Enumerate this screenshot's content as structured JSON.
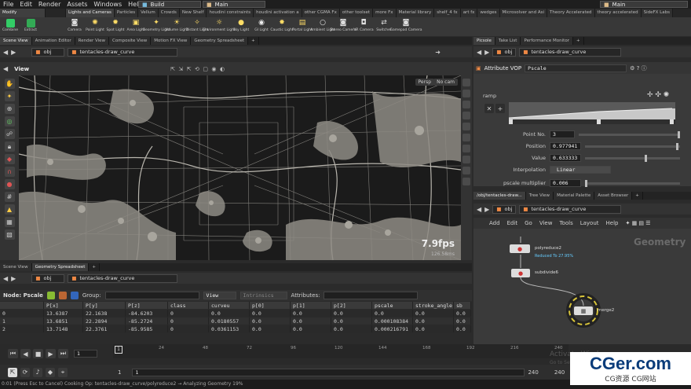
{
  "menubar": {
    "items": [
      "File",
      "Edit",
      "Render",
      "Assets",
      "Windows",
      "Help"
    ],
    "build_desk": "Build",
    "main_desk": "Main",
    "right_desk": "Main"
  },
  "shelf_tabs": [
    "Modify",
    "Lights and Cameras",
    "Particles",
    "Vellum",
    "Crowds",
    "New Shelf",
    "houdini constraints",
    "houdini activation a",
    "other CGMA Fx",
    "other toolset",
    "more Fx",
    "Material library",
    "shelf_4 fx",
    "art fx",
    "wedges",
    "Microsolver and Asi",
    "Theory Accelerated",
    "theory accelerated",
    "SideFX Labs"
  ],
  "tools_left": [
    "Combine",
    "Extract"
  ],
  "tools": [
    "Camera",
    "Point Light",
    "Spot Light",
    "Area Light",
    "Geometry Light",
    "Volume Light",
    "Distant Light",
    "Environment Light",
    "Sky Light",
    "GI Light",
    "Caustic Light",
    "Portal Light",
    "Ambient Light",
    "Stereo Camera",
    "VR Camera",
    "Switcher",
    "Gamepad Camera"
  ],
  "viewer": {
    "tabs": [
      "Scene View",
      "Animation Editor",
      "Render View",
      "Composite View",
      "Motion FX View",
      "Geometry Spreadsheet"
    ],
    "path_root": "obj",
    "path_node": "tentacles-draw_curve",
    "title": "View",
    "persp": "Persp",
    "cam": "No cam",
    "fps": "7.9fps",
    "ms": "126.58ms"
  },
  "right_top": {
    "tabs": [
      "Picsole",
      "Take List",
      "Performance Monitor"
    ],
    "path_root": "obj",
    "path_node": "tentacles-draw_curve",
    "node_type": "Attribute VOP",
    "node_name": "Pscale"
  },
  "parms": {
    "ramp_label": "ramp",
    "point_no_label": "Point No.",
    "point_no": "3",
    "position_label": "Position",
    "position": "0.977941",
    "value_label": "Value",
    "value": "0.633333",
    "interp_label": "Interpolation",
    "interp": "Linear",
    "mult_label": "pscale multiplier",
    "mult": "0.006"
  },
  "network": {
    "tabs": [
      "/obj/tentacles-draw...",
      "Tree View",
      "Material Palette",
      "Asset Browser"
    ],
    "path_root": "obj",
    "path_node": "tentacles-draw_curve",
    "menu": [
      "Add",
      "Edit",
      "Go",
      "View",
      "Tools",
      "Layout",
      "Help"
    ],
    "context_label": "Geometry",
    "nodes": [
      {
        "name": "polyreduce2",
        "info": "Reduced To 27.95%"
      },
      {
        "name": "subdivide6",
        "info": ""
      },
      {
        "name": "merge2",
        "info": ""
      }
    ]
  },
  "spreadsheet": {
    "tabs": [
      "Scene View",
      "Geometry Spreadsheet"
    ],
    "path_root": "obj",
    "path_node": "tentacles-draw_curve",
    "node_label": "Node: Pscale",
    "group_label": "Group:",
    "view_label": "View",
    "intrinsics_label": "Intrinsics",
    "attributes_label": "Attributes:",
    "columns": [
      "",
      "P[x]",
      "P[y]",
      "P[z]",
      "class",
      "curveu",
      "p[0]",
      "p[1]",
      "p[2]",
      "pscale",
      "stroke_angle",
      "sb"
    ],
    "rows": [
      [
        "0",
        "13.6387",
        "22.1638",
        "-84.6203",
        "0",
        "0.0",
        "0.0",
        "0.0",
        "0.0",
        "0.0",
        "0.0",
        "0.0"
      ],
      [
        "1",
        "13.6851",
        "22.2894",
        "-85.2724",
        "0",
        "0.0180557",
        "0.0",
        "0.0",
        "0.0",
        "0.000108384",
        "0.0",
        "0.0"
      ],
      [
        "2",
        "13.7148",
        "22.3761",
        "-85.9585",
        "0",
        "0.0361153",
        "0.0",
        "0.0",
        "0.0",
        "0.000216791",
        "0.0",
        "0.0"
      ]
    ]
  },
  "timeline": {
    "current_frame": "1",
    "ticks": [
      "1",
      "24",
      "48",
      "72",
      "96",
      "120",
      "144",
      "168",
      "192",
      "216",
      "240"
    ],
    "start": "1",
    "start2": "1",
    "end": "240",
    "end2": "240",
    "activate_text": "Activate Windows",
    "activate_sub": "Go to Settings to activate Windows."
  },
  "status": "0:01 (Press Esc to Cancel) Cooking Op: tentacles-draw_curve/polyreduce2 → Analyzing Geometry 19%",
  "watermark": {
    "logo": "CGer.com",
    "sub": "CG资源 CG网站"
  }
}
